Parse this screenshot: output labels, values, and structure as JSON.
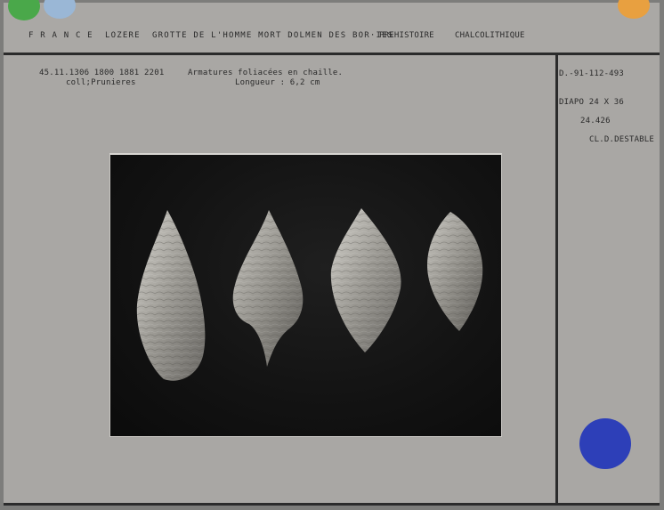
{
  "header": {
    "location": "F R A N C E  LOZERE  GROTTE DE L'HOMME MORT DOLMEN DES BOR·IES",
    "period": "PREHISTOIRE",
    "culture": "CHALCOLITHIQUE"
  },
  "left_meta": {
    "coords": "45.11.1306 1800 1881 2201",
    "collection": "coll;Prunieres"
  },
  "description": {
    "title": "Armatures foliacées en chaille.",
    "length": "Longueur : 6,2 cm"
  },
  "right_meta": {
    "inventory": "D.-91-112-493",
    "format": "DIAPO 24 X 36",
    "number": "24.426",
    "credit": "CL.D.DESTABLE"
  },
  "colors": {
    "dot_green": "#4aa84a",
    "dot_light_blue": "#9ab7d6",
    "dot_orange": "#e8a040",
    "dot_blue": "#2d3fb8"
  },
  "photo": {
    "subject_count": 4
  }
}
